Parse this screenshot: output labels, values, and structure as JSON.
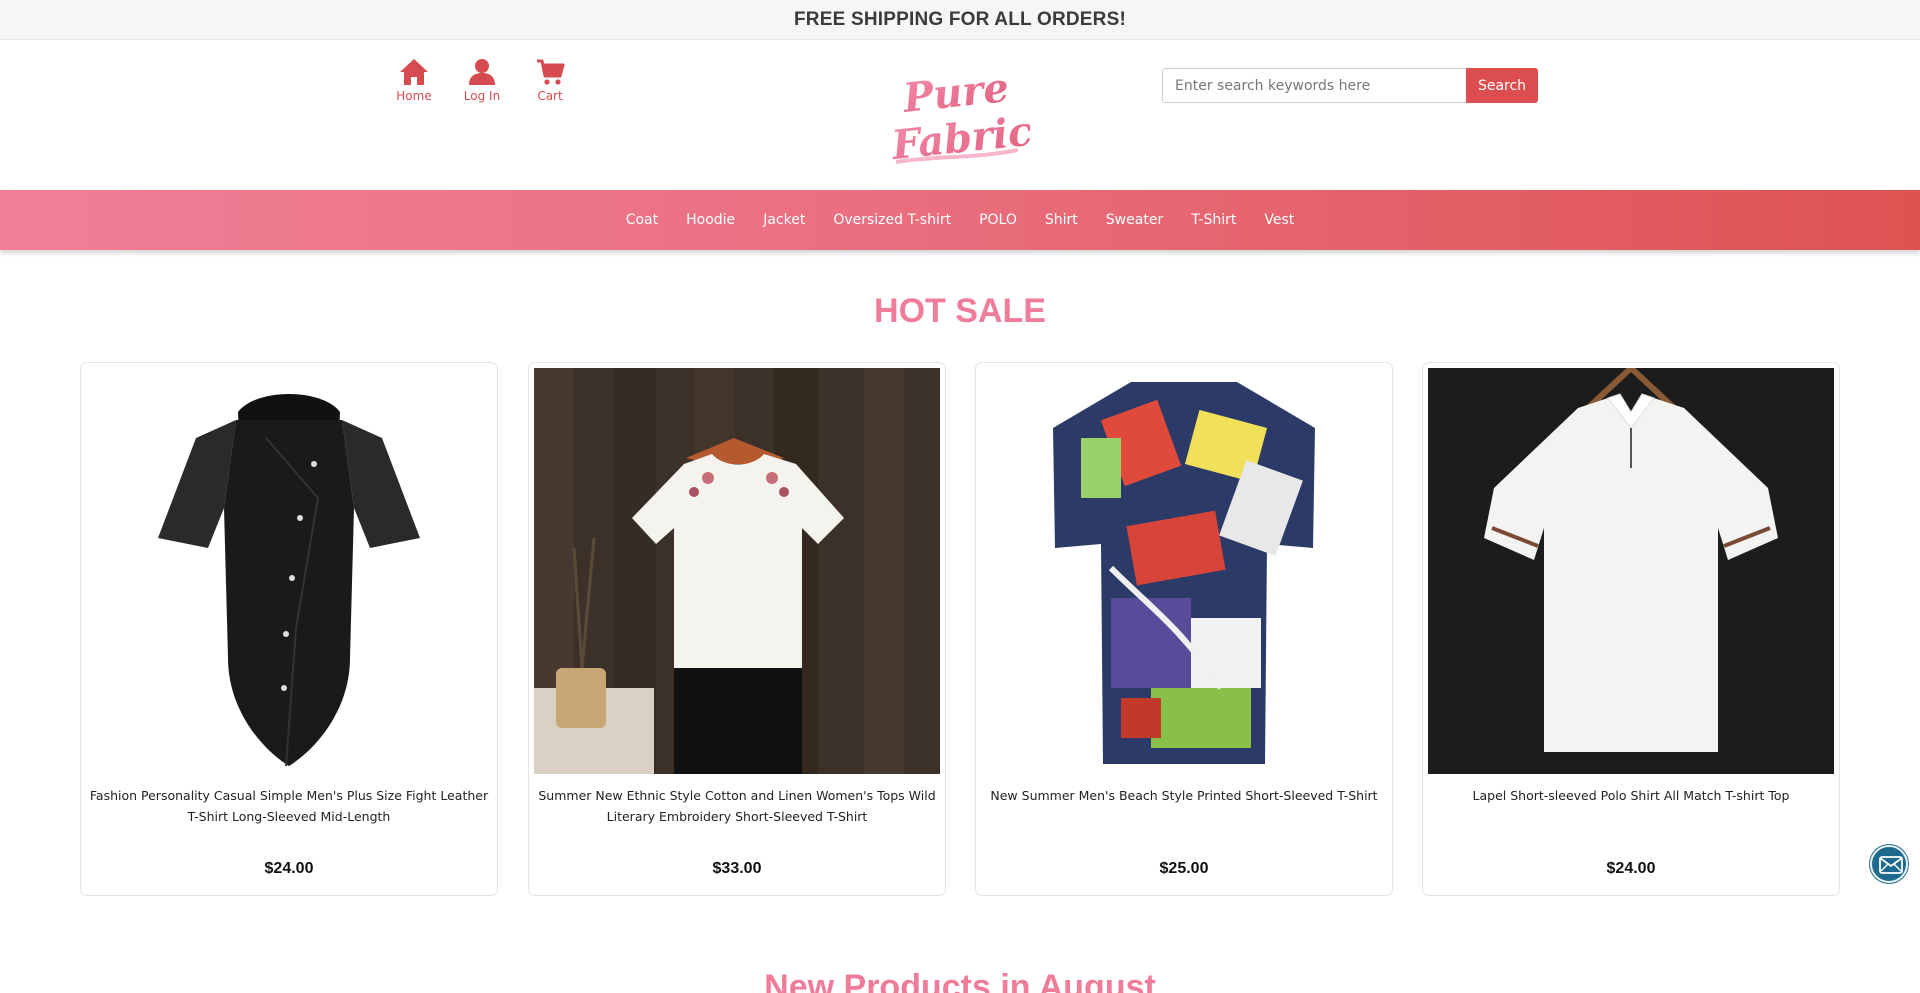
{
  "announcement": "FREE SHIPPING FOR ALL ORDERS!",
  "nav": [
    {
      "label": "Home",
      "icon": "home-icon"
    },
    {
      "label": "Log In",
      "icon": "user-icon"
    },
    {
      "label": "Cart",
      "icon": "cart-icon"
    }
  ],
  "logo": {
    "line1": "Pure",
    "line2": "Fabric"
  },
  "search": {
    "placeholder": "Enter search keywords here",
    "value": "",
    "button_label": "Search"
  },
  "categories": [
    "Coat",
    "Hoodie",
    "Jacket",
    "Oversized T-shirt",
    "POLO",
    "Shirt",
    "Sweater",
    "T-Shirt",
    "Vest"
  ],
  "hot_sale": {
    "title": "HOT SALE",
    "products": [
      {
        "name": "Fashion Personality Casual Simple Men's Plus Size Fight Leather T-Shirt Long-Sleeved Mid-Length",
        "price": "$24.00"
      },
      {
        "name": "Summer New Ethnic Style Cotton and Linen Women's Tops Wild Literary Embroidery Short-Sleeved T-Shirt",
        "price": "$33.00"
      },
      {
        "name": "New Summer Men's Beach Style Printed Short-Sleeved T-Shirt",
        "price": "$25.00"
      },
      {
        "name": "Lapel Short-sleeved Polo Shirt All Match T-shirt Top",
        "price": "$24.00"
      }
    ]
  },
  "new_products_title": "New Products in August",
  "colors": {
    "accent": "#dc4d50",
    "pink": "#ef7d99",
    "mail": "#1d6a8e"
  }
}
